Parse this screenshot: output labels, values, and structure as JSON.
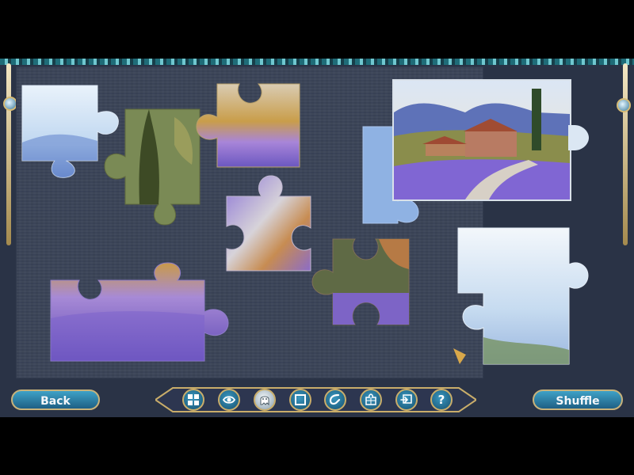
{
  "buttons": {
    "back": "Back",
    "shuffle": "Shuffle"
  },
  "toolbar": {
    "tools": [
      {
        "name": "pieces-grid",
        "icon": "grid-icon"
      },
      {
        "name": "preview",
        "icon": "eye-icon"
      },
      {
        "name": "ghost",
        "icon": "ghost-icon"
      },
      {
        "name": "frame",
        "icon": "square-frame-icon"
      },
      {
        "name": "magnet",
        "icon": "magnet-icon"
      },
      {
        "name": "edges",
        "icon": "puzzle-piece-icon"
      },
      {
        "name": "box",
        "icon": "box-icon"
      },
      {
        "name": "help",
        "icon": "question-icon",
        "label": "?"
      }
    ]
  },
  "colors": {
    "board": "#3b4458",
    "background": "#2a3346",
    "button": "#2d83ad",
    "gold": "#c9ad6a",
    "lavender": "#8b72d3",
    "sky": "#c7ddf1"
  }
}
